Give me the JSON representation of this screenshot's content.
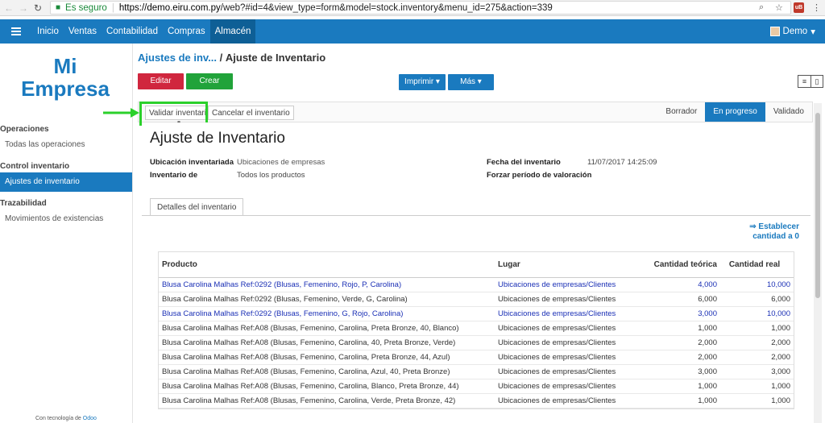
{
  "browser": {
    "secure_label": "Es seguro",
    "url_host": "https://demo.eiru.com.py",
    "url_path": "/web?#id=4&view_type=form&model=stock.inventory&menu_id=275&action=339"
  },
  "topnav": {
    "items": [
      "Inicio",
      "Ventas",
      "Contabilidad",
      "Compras",
      "Almacén"
    ],
    "user": "Demo"
  },
  "sidebar": {
    "logo_line1": "Mi",
    "logo_line2": "Empresa",
    "sections": [
      {
        "title": "Operaciones",
        "items": [
          "Todas las operaciones"
        ]
      },
      {
        "title": "Control inventario",
        "items": [
          "Ajustes de inventario"
        ]
      },
      {
        "title": "Trazabilidad",
        "items": [
          "Movimientos de existencias"
        ]
      }
    ],
    "powered_prefix": "Con tecnología de",
    "powered_brand": "Odoo"
  },
  "breadcrumb": {
    "parent": "Ajustes de inv...",
    "separator": "/",
    "current": "Ajuste de Inventario"
  },
  "toolbar": {
    "edit": "Editar",
    "create": "Crear",
    "print": "Imprimir ▾",
    "more": "Más ▾"
  },
  "actions": {
    "validate": "Validar inventario",
    "cancel": "Cancelar el inventario"
  },
  "stages": [
    "Borrador",
    "En progreso",
    "Validado"
  ],
  "form": {
    "title": "Ajuste de Inventario",
    "location_label": "Ubicación inventariada",
    "location_value": "Ubicaciones de empresas",
    "inventory_of_label": "Inventario de",
    "inventory_of_value": "Todos los productos",
    "date_label": "Fecha del inventario",
    "date_value": "11/07/2017 14:25:09",
    "force_label": "Forzar período de valoración",
    "tab": "Detalles del inventario",
    "set_qty_line1": "⇒ Establecer",
    "set_qty_line2": "cantidad a 0"
  },
  "table": {
    "headers": [
      "Producto",
      "Lugar",
      "Cantidad teórica",
      "Cantidad real"
    ],
    "rows": [
      {
        "product": "Blusa Carolina Malhas Ref:0292 (Blusas, Femenino, Rojo, P, Carolina)",
        "place": "Ubicaciones de empresas/Clientes",
        "theo": "4,000",
        "real": "10,000",
        "highlight": true
      },
      {
        "product": "Blusa Carolina Malhas Ref:0292 (Blusas, Femenino, Verde, G, Carolina)",
        "place": "Ubicaciones de empresas/Clientes",
        "theo": "6,000",
        "real": "6,000",
        "highlight": false
      },
      {
        "product": "Blusa Carolina Malhas Ref:0292 (Blusas, Femenino, G, Rojo, Carolina)",
        "place": "Ubicaciones de empresas/Clientes",
        "theo": "3,000",
        "real": "10,000",
        "highlight": true
      },
      {
        "product": "Blusa Carolina Malhas Ref:A08 (Blusas, Femenino, Carolina, Preta Bronze, 40, Blanco)",
        "place": "Ubicaciones de empresas/Clientes",
        "theo": "1,000",
        "real": "1,000",
        "highlight": false
      },
      {
        "product": "Blusa Carolina Malhas Ref:A08 (Blusas, Femenino, Carolina, 40, Preta Bronze, Verde)",
        "place": "Ubicaciones de empresas/Clientes",
        "theo": "2,000",
        "real": "2,000",
        "highlight": false
      },
      {
        "product": "Blusa Carolina Malhas Ref:A08 (Blusas, Femenino, Carolina, Preta Bronze, 44, Azul)",
        "place": "Ubicaciones de empresas/Clientes",
        "theo": "2,000",
        "real": "2,000",
        "highlight": false
      },
      {
        "product": "Blusa Carolina Malhas Ref:A08 (Blusas, Femenino, Carolina, Azul, 40, Preta Bronze)",
        "place": "Ubicaciones de empresas/Clientes",
        "theo": "3,000",
        "real": "3,000",
        "highlight": false
      },
      {
        "product": "Blusa Carolina Malhas Ref:A08 (Blusas, Femenino, Carolina, Blanco, Preta Bronze, 44)",
        "place": "Ubicaciones de empresas/Clientes",
        "theo": "1,000",
        "real": "1,000",
        "highlight": false
      },
      {
        "product": "Blusa Carolina Malhas Ref:A08 (Blusas, Femenino, Carolina, Verde, Preta Bronze, 42)",
        "place": "Ubicaciones de empresas/Clientes",
        "theo": "1,000",
        "real": "1,000",
        "highlight": false
      }
    ]
  },
  "colors": {
    "brand": "#1a7abf",
    "edit": "#d0263e",
    "create": "#21a33a",
    "highlight": "#2bd02b",
    "link_row": "#1a2fb5"
  }
}
